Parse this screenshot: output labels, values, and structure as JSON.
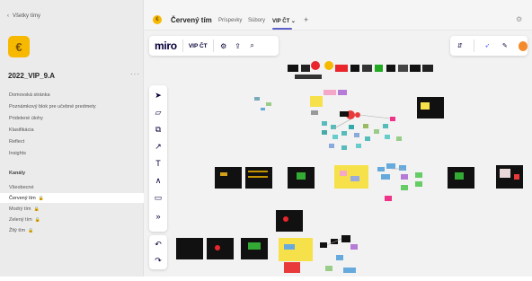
{
  "sidebar": {
    "back_label": "Všetky tímy",
    "team_avatar": "€",
    "team_name": "2022_VIP_9.A",
    "more_label": "···",
    "nav": [
      "Domovská stránka",
      "Poznámkový blok pre učebné predmety",
      "Pridelené úlohy",
      "Klasifikácia",
      "Reflect",
      "Insights"
    ],
    "channels_title": "Kanály",
    "channels": [
      {
        "label": "Všeobecné",
        "lock": ""
      },
      {
        "label": "Červený tím",
        "lock": "🔒"
      },
      {
        "label": "Modrý tím",
        "lock": "🔒"
      },
      {
        "label": "Zelený tím",
        "lock": "🔒"
      },
      {
        "label": "Žltý tím",
        "lock": "🔒"
      }
    ]
  },
  "topbar": {
    "avatar": "€",
    "title": "Červený tím",
    "tabs": [
      "Príspevky",
      "Súbory",
      "VIP ČT ⌄"
    ],
    "plus": "+"
  },
  "miro": {
    "logo": "miro",
    "board_name": "VIP ČT"
  },
  "colors": {
    "sidebar_bg": "#ebebeb",
    "accent": "#5b5fc7",
    "miro_blue": "#4262ff",
    "board_bg": "#f2f2f2"
  }
}
